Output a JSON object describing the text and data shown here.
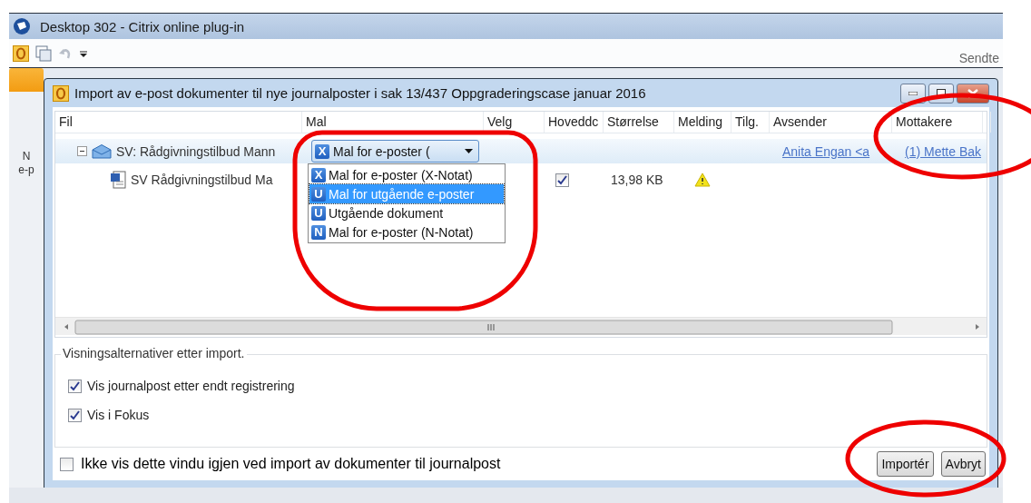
{
  "outer_window": {
    "title": "Desktop 302 - Citrix online plug-in"
  },
  "toolbar": {
    "right_label": "Sendte"
  },
  "left_pane": {
    "labels": [
      "N",
      "e-p"
    ]
  },
  "dialog": {
    "title": "Import av e-post dokumenter til nye journalposter i sak 13/437 Oppgraderingscase januar 2016"
  },
  "table": {
    "columns": [
      "Fil",
      "Mal",
      "Velg",
      "Hoveddc",
      "Størrelse",
      "Melding",
      "Tilg.",
      "Avsender",
      "Mottakere"
    ],
    "rows": [
      {
        "kind": "email",
        "expanded": true,
        "file": "SV: Rådgivningstilbud Mann",
        "template": {
          "badge": "X",
          "label": "Mal for e-poster (",
          "open": true,
          "options": [
            {
              "badge": "X",
              "label": "Mal for e-poster (X-Notat)",
              "selected": false
            },
            {
              "badge": "U",
              "label": "Mal for utgående e-poster",
              "selected": true
            },
            {
              "badge": "U",
              "label": "Utgående dokument",
              "selected": false
            },
            {
              "badge": "N",
              "label": "Mal for e-poster (N-Notat)",
              "selected": false
            }
          ]
        },
        "sender": "Anita Engan <a",
        "recipients": "(1) Mette Bak"
      },
      {
        "kind": "document",
        "file": "SV Rådgivningstilbud Ma",
        "main_document": true,
        "size": "13,98 KB",
        "warning": true
      }
    ]
  },
  "view_options": {
    "title": "Visningsalternativer etter import.",
    "options": [
      {
        "label": "Vis journalpost etter endt registrering",
        "checked": true
      },
      {
        "label": "Vis i Fokus",
        "checked": true
      }
    ]
  },
  "dont_show_again": {
    "label": "Ikke vis dette vindu igjen ved import av dokumenter til journalpost",
    "checked": false
  },
  "buttons": [
    "Importér",
    "Avbryt"
  ],
  "annotation_marks": [
    {
      "kind": "ellipse"
    },
    {
      "kind": "ellipse"
    },
    {
      "kind": "ellipse"
    }
  ]
}
